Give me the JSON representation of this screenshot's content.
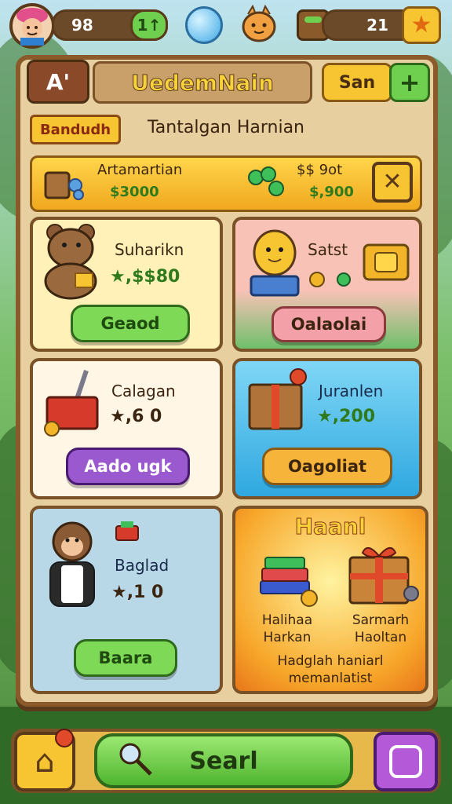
{
  "top_bar": {
    "level": "98",
    "level_button": "1↑",
    "coins": "21"
  },
  "header": {
    "left_label": "A'",
    "title": "UedemNain",
    "right_label": "San"
  },
  "subheader": {
    "badge": "Bandudh",
    "subtitle": "Tantalgan Harnian"
  },
  "banner": {
    "name": "Artamartian",
    "amount": "$3000",
    "right_top": "$$ 9ot",
    "right_bottom": "$,900"
  },
  "cards": [
    {
      "title": "Suharikn",
      "value": "★,$$80",
      "button": "Geaod",
      "accent": "#7ed957"
    },
    {
      "title": "Satst",
      "value": "",
      "button": "Oalaolai",
      "accent": "#f4a0a8"
    },
    {
      "title": "Calagan",
      "value": "★,6  0",
      "button": "Aado ugk",
      "accent": "#9b59d0"
    },
    {
      "title": "Juranlen",
      "value": "★,200",
      "button": "Oagoliat",
      "accent": "#f6b53a"
    },
    {
      "title": "Baglad",
      "value": "★,1  0",
      "button": "Baara",
      "accent": "#7ed957"
    }
  ],
  "feature": {
    "title": "Haanl",
    "item1": [
      "Halihaa",
      "Harkan"
    ],
    "item2": [
      "Sarmarh",
      "Haoltan"
    ],
    "footer": [
      "Hadglah haniarl",
      "memanlatist"
    ]
  },
  "bottom": {
    "main_button": "Searl"
  },
  "colors": {
    "panel": "#e7cfa0",
    "frame": "#8a5a2b",
    "gold": "#f7c531",
    "green": "#6fcf4f"
  }
}
